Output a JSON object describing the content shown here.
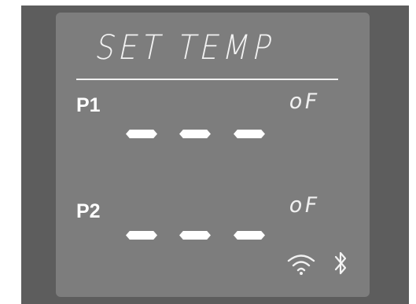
{
  "display": {
    "title": "SET TEMP",
    "probes": [
      {
        "label": "P1",
        "reading": "- - -",
        "unit": "oF"
      },
      {
        "label": "P2",
        "reading": "- - -",
        "unit": "oF"
      }
    ],
    "icons": [
      "wifi-icon",
      "bluetooth-icon"
    ]
  }
}
